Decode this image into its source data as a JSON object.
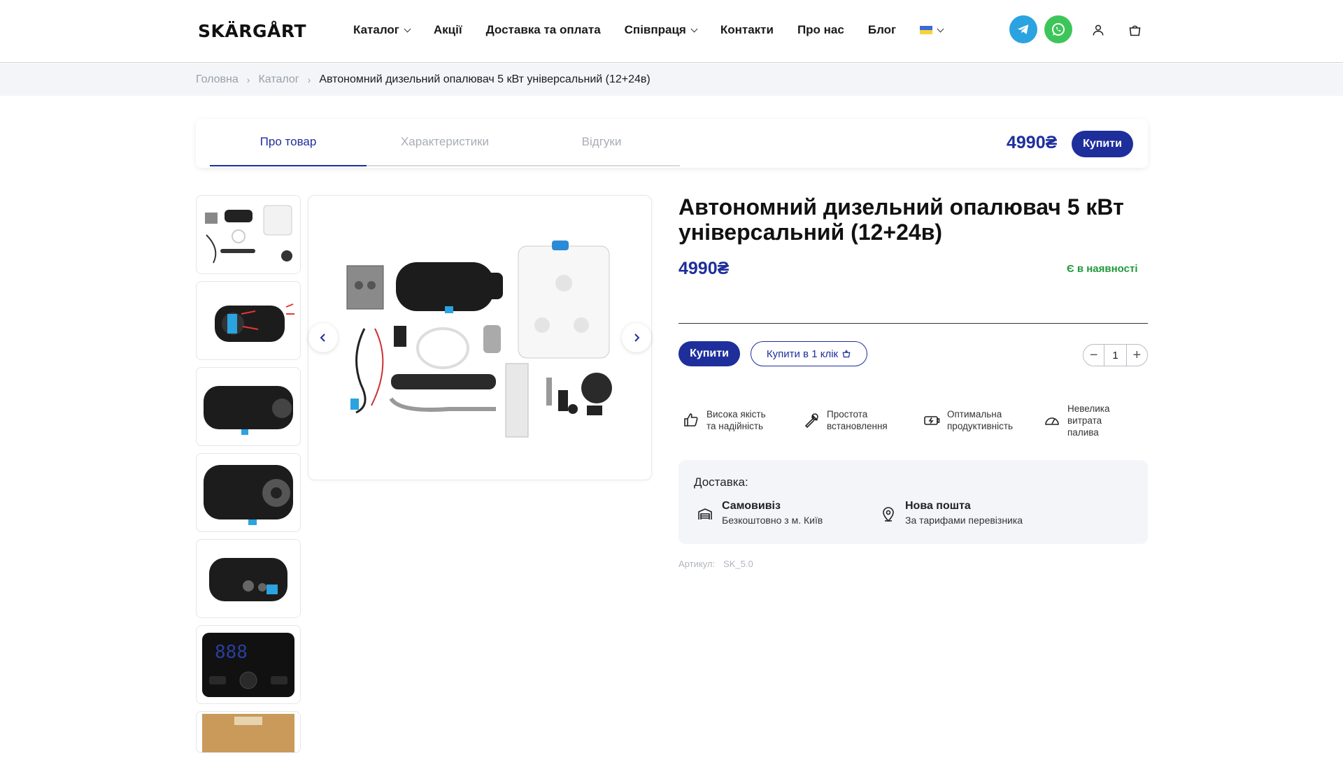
{
  "header": {
    "logo": "SKÄRGÅRT",
    "nav": [
      {
        "label": "Каталог",
        "dropdown": true
      },
      {
        "label": "Акції",
        "dropdown": false
      },
      {
        "label": "Доставка та оплата",
        "dropdown": false
      },
      {
        "label": "Співпраця",
        "dropdown": true
      },
      {
        "label": "Контакти",
        "dropdown": false
      },
      {
        "label": "Про нас",
        "dropdown": false
      },
      {
        "label": "Блог",
        "dropdown": false
      }
    ],
    "icons": [
      "ukraine-flag-icon",
      "telegram-icon",
      "whatsapp-icon",
      "user-icon",
      "cart-icon"
    ],
    "colors": {
      "telegram": "#2aa3e0",
      "whatsapp": "#3ec55a"
    }
  },
  "breadcrumb": {
    "items": [
      "Головна",
      "Каталог"
    ],
    "current": "Автономний дизельний опалювач 5 кВт універсальний (12+24в)"
  },
  "tabs": {
    "items": [
      "Про товар",
      "Характеристики",
      "Відгуки"
    ],
    "active": "Про товар",
    "price": "4990₴",
    "buy_label": "Купити"
  },
  "product": {
    "title": "Автономний дизельний опалювач 5 кВт універсальний (12+24в)",
    "price": "4990₴",
    "stock": "Є в наявності",
    "buy_label": "Купити",
    "oneclick_label": "Купити в 1 клік",
    "quantity": "1",
    "accent_color": "#1e2f9c",
    "stock_color": "#1e9a3a"
  },
  "features": [
    {
      "icon": "thumbs-up-icon",
      "line1": "Висока якість",
      "line2": "та надійність",
      "line3": ""
    },
    {
      "icon": "wrench-icon",
      "line1": "Простота",
      "line2": "встановлення",
      "line3": ""
    },
    {
      "icon": "battery-icon",
      "line1": "Оптимальна",
      "line2": "продуктивність",
      "line3": ""
    },
    {
      "icon": "gauge-icon",
      "line1": "Невелика",
      "line2": "витрата",
      "line3": "палива"
    }
  ],
  "delivery": {
    "title": "Доставка:",
    "options": [
      {
        "icon": "store-icon",
        "name": "Самовивіз",
        "desc": "Безкоштовно з м. Київ"
      },
      {
        "icon": "location-pin-icon",
        "name": "Нова пошта",
        "desc": "За тарифами перевізника"
      }
    ]
  },
  "article": {
    "label": "Артикул:",
    "value": "SK_5.0"
  }
}
